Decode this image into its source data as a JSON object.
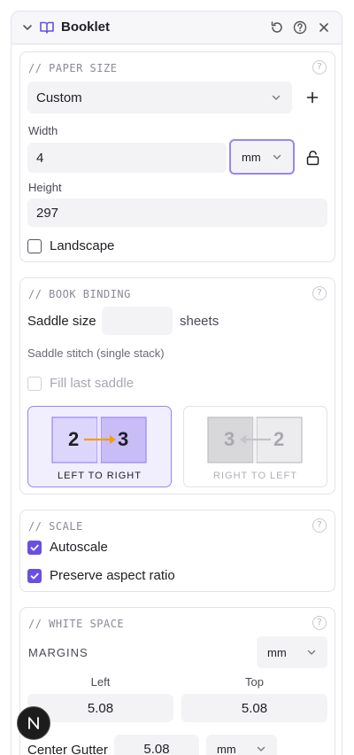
{
  "panel": {
    "title": "Booklet"
  },
  "paper_size": {
    "section_title": "// PAPER SIZE",
    "help": "?",
    "preset_value": "Custom",
    "add_label": "+",
    "width_label": "Width",
    "width_value": "4",
    "unit_value": "mm",
    "height_label": "Height",
    "height_value": "297",
    "landscape_label": "Landscape",
    "landscape_checked": false
  },
  "book_binding": {
    "section_title": "// BOOK BINDING",
    "help": "?",
    "saddle_label": "Saddle size",
    "saddle_value": "",
    "sheets_label": "sheets",
    "stitch_note": "Saddle stitch (single stack)",
    "fill_last_label": "Fill last saddle",
    "ltr": {
      "left": "2",
      "right": "3",
      "label": "LEFT TO RIGHT"
    },
    "rtl": {
      "left": "3",
      "right": "2",
      "label": "RIGHT TO LEFT"
    }
  },
  "scale": {
    "section_title": "// SCALE",
    "help": "?",
    "autoscale_label": "Autoscale",
    "preserve_label": "Preserve aspect ratio"
  },
  "white_space": {
    "section_title": "// WHITE SPACE",
    "help": "?",
    "margins_label": "MARGINS",
    "margins_unit": "mm",
    "left_label": "Left",
    "left_value": "5.08",
    "top_label": "Top",
    "top_value": "5.08",
    "gutter_label": "Center Gutter",
    "gutter_value": "5.08",
    "gutter_unit": "mm"
  },
  "colors": {
    "accent": "#6a4fe0",
    "accent_soft": "#f1eefe",
    "arrow": "#f39c12"
  }
}
